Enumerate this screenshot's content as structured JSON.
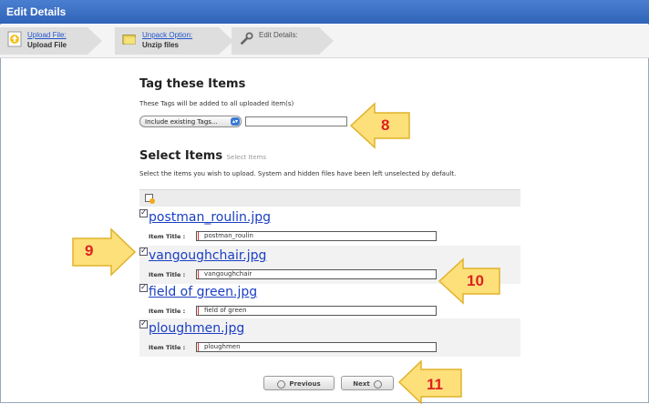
{
  "window": {
    "title": "Edit Details"
  },
  "steps": [
    {
      "link": "Upload File:",
      "label": "Upload File"
    },
    {
      "link": "Unpack Option:",
      "label": "Unzip files"
    },
    {
      "link": "Edit Details:",
      "label": ""
    }
  ],
  "tags": {
    "heading": "Tag these Items",
    "description": "These Tags will be added to all uploaded item(s)",
    "select_value": "Include existing Tags...",
    "input_value": ""
  },
  "select_items": {
    "heading": "Select Items",
    "heading_suffix": "Select Items",
    "description": "Select the items you wish to upload. System and hidden files have been left unselected by default.",
    "item_title_label": "Item Title :",
    "items": [
      {
        "filename": "postman_roulin.jpg",
        "title": "postman_roulin",
        "checked": true
      },
      {
        "filename": "vangoughchair.jpg",
        "title": "vangoughchair",
        "checked": true
      },
      {
        "filename": "field of green.jpg",
        "title": "field of green",
        "checked": true
      },
      {
        "filename": "ploughmen.jpg",
        "title": "ploughmen",
        "checked": true
      }
    ]
  },
  "buttons": {
    "previous": "Previous",
    "next": "Next"
  },
  "callouts": [
    "8",
    "9",
    "10",
    "11"
  ],
  "colors": {
    "titlebar": "#2f63b8",
    "link": "#1a3fc4",
    "callout_fill": "#fde07a",
    "callout_text": "#d22222"
  }
}
